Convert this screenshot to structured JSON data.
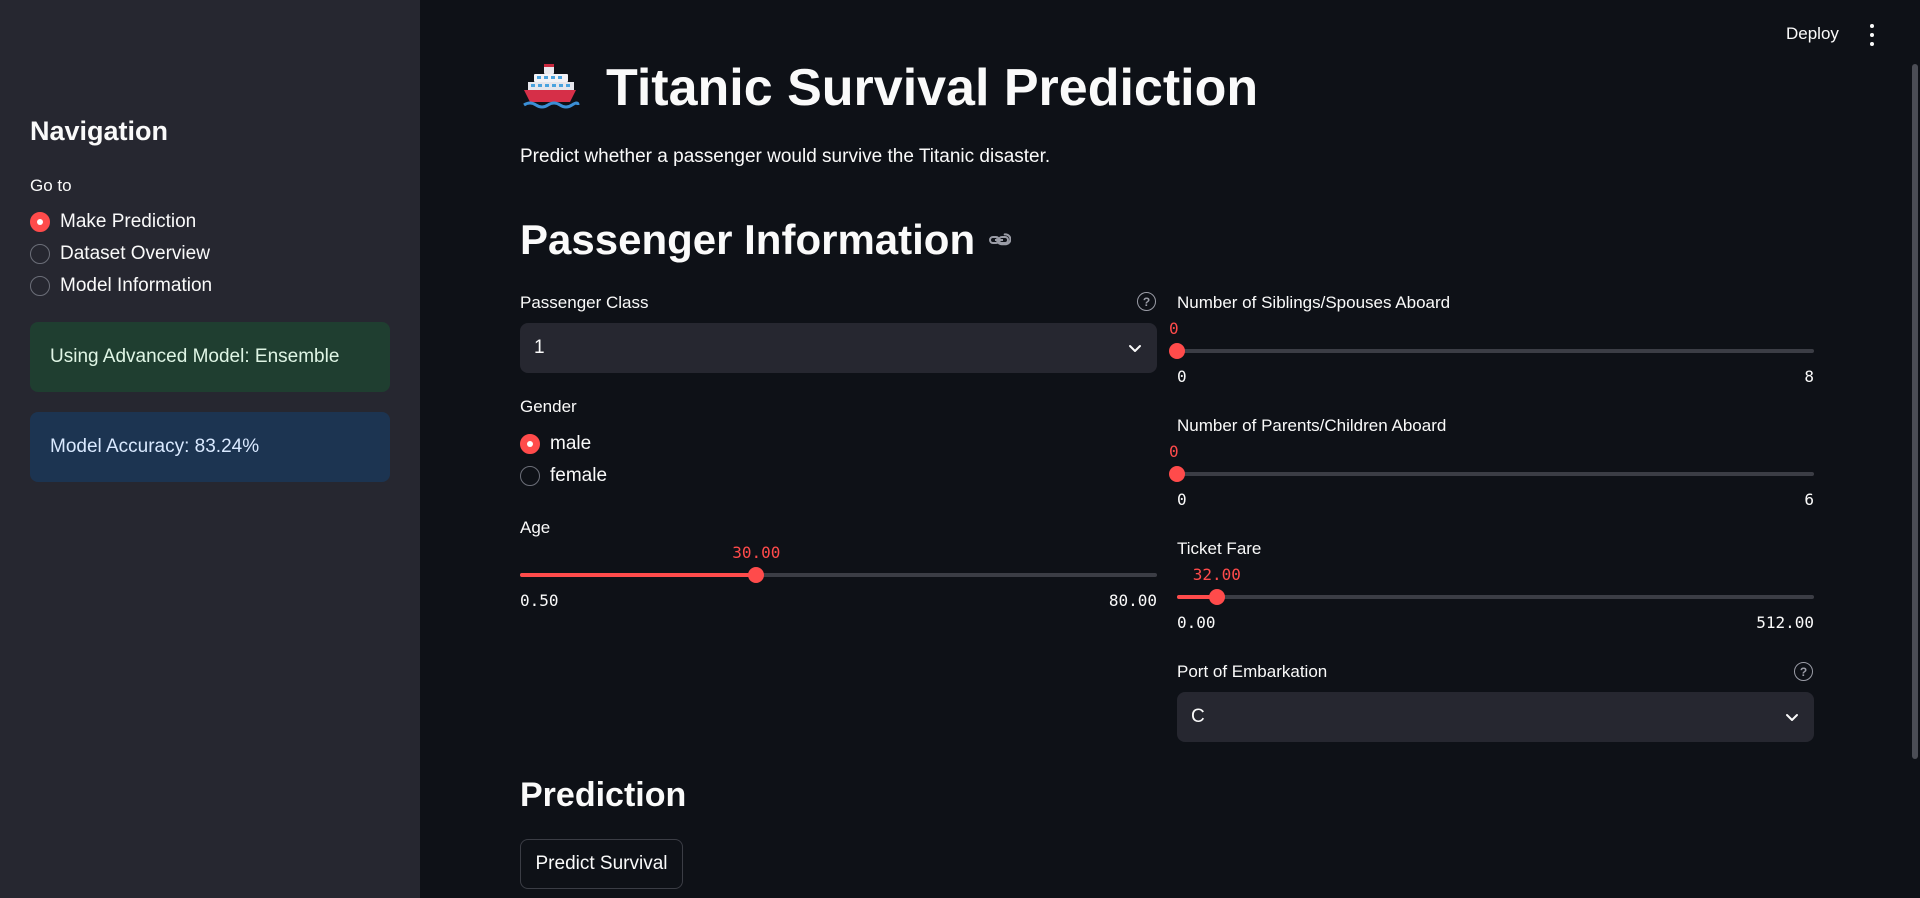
{
  "sidebar": {
    "title": "Navigation",
    "goto_label": "Go to",
    "options": [
      {
        "label": "Make Prediction",
        "selected": true
      },
      {
        "label": "Dataset Overview",
        "selected": false
      },
      {
        "label": "Model Information",
        "selected": false
      }
    ],
    "model_alert": "Using Advanced Model: Ensemble",
    "accuracy_alert": "Model Accuracy: 83.24%"
  },
  "topbar": {
    "deploy_label": "Deploy",
    "menu_icon": "kebab-menu-icon"
  },
  "header": {
    "icon": "ship-icon",
    "title": "Titanic Survival Prediction",
    "subtitle": "Predict whether a passenger would survive the Titanic disaster."
  },
  "passenger_info": {
    "title": "Passenger Information",
    "passenger_class": {
      "label": "Passenger Class",
      "value": "1"
    },
    "gender": {
      "label": "Gender",
      "options": [
        {
          "label": "male",
          "selected": true
        },
        {
          "label": "female",
          "selected": false
        }
      ]
    },
    "age": {
      "label": "Age",
      "value": 30.0,
      "value_text": "30.00",
      "min": 0.5,
      "max": 80.0,
      "min_text": "0.50",
      "max_text": "80.00"
    },
    "siblings": {
      "label": "Number of Siblings/Spouses Aboard",
      "value": 0,
      "value_text": "0",
      "min": 0,
      "max": 8,
      "min_text": "0",
      "max_text": "8"
    },
    "parents": {
      "label": "Number of Parents/Children Aboard",
      "value": 0,
      "value_text": "0",
      "min": 0,
      "max": 6,
      "min_text": "0",
      "max_text": "6"
    },
    "fare": {
      "label": "Ticket Fare",
      "value": 32.0,
      "value_text": "32.00",
      "min": 0,
      "max": 512,
      "min_text": "0.00",
      "max_text": "512.00"
    },
    "embarkation": {
      "label": "Port of Embarkation",
      "value": "C"
    }
  },
  "prediction": {
    "title": "Prediction",
    "button_label": "Predict Survival"
  },
  "colors": {
    "accent": "#ff4b4b",
    "background": "#0e1117",
    "sidebar": "#262730"
  }
}
